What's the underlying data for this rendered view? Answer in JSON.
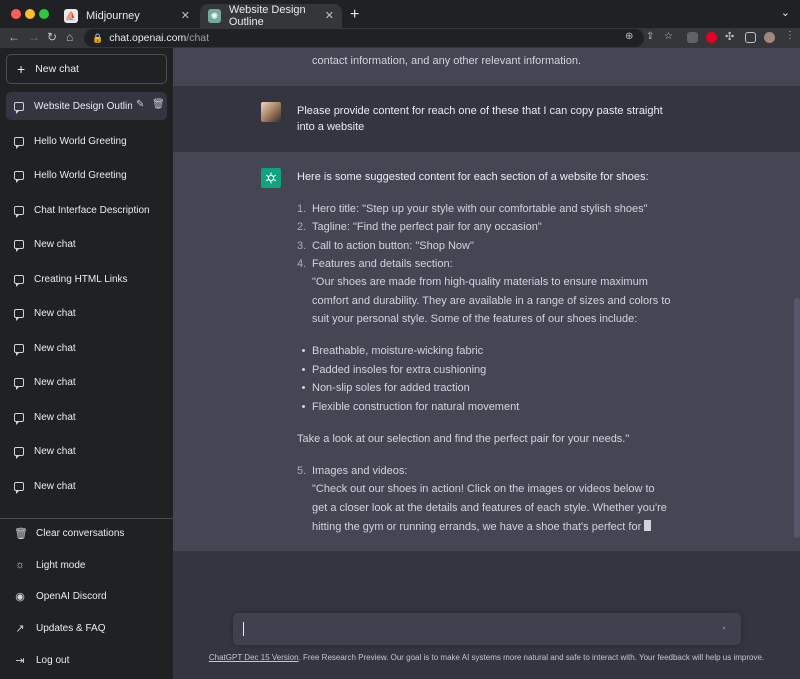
{
  "browser": {
    "tabs": [
      {
        "title": "Midjourney",
        "active": false
      },
      {
        "title": "Website Design Outline",
        "active": true
      }
    ],
    "url_host": "chat.openai.com",
    "url_path": "/chat"
  },
  "sidebar": {
    "new_chat_label": "New chat",
    "items": [
      {
        "label": "Website Design Outlin",
        "active": true
      },
      {
        "label": "Hello World Greeting"
      },
      {
        "label": "Hello World Greeting"
      },
      {
        "label": "Chat Interface Description"
      },
      {
        "label": "New chat"
      },
      {
        "label": "Creating HTML Links"
      },
      {
        "label": "New chat"
      },
      {
        "label": "New chat"
      },
      {
        "label": "New chat"
      },
      {
        "label": "New chat"
      },
      {
        "label": "New chat"
      },
      {
        "label": "New chat"
      }
    ],
    "bottom": {
      "clear": "Clear conversations",
      "light": "Light mode",
      "discord": "OpenAI Discord",
      "updates": "Updates & FAQ",
      "logout": "Log out"
    }
  },
  "chat": {
    "previous_tail": "contact information, and any other relevant information.",
    "user_message_line1": "Please provide content for reach one of these that I can copy paste straight",
    "user_message_line2": "into a website",
    "assistant": {
      "intro": "Here is some suggested content for each section of a website for shoes:",
      "list": [
        {
          "num": "1.",
          "text": "Hero title: \"Step up your style with our comfortable and stylish shoes\""
        },
        {
          "num": "2.",
          "text": "Tagline: \"Find the perfect pair for any occasion\""
        },
        {
          "num": "3.",
          "text": "Call to action button: \"Shop Now\""
        },
        {
          "num": "4.",
          "text": "Features and details section:"
        }
      ],
      "features_para": [
        "\"Our shoes are made from high-quality materials to ensure maximum",
        "comfort and durability. They are available in a range of sizes and colors to",
        "suit your personal style. Some of the features of our shoes include:"
      ],
      "bullets": [
        "Breathable, moisture-wicking fabric",
        "Padded insoles for extra cushioning",
        "Non-slip soles for added traction",
        "Flexible construction for natural movement"
      ],
      "closing": "Take a look at our selection and find the perfect pair for your needs.\"",
      "item5_num": "5.",
      "item5_title": "Images and videos:",
      "item5_para": [
        "\"Check out our shoes in action! Click on the images or videos below to",
        "get a closer look at the details and features of each style. Whether you're",
        "hitting the gym or running errands, we have a shoe that's perfect for"
      ]
    }
  },
  "footer": {
    "version_link": "ChatGPT Dec 15 Version",
    "text": ". Free Research Preview. Our goal is to make AI systems more natural and safe to interact with. Your feedback will help us improve."
  },
  "colors": {
    "sidebar_bg": "#202123",
    "main_bg": "#343541",
    "assistant_bg": "#444654",
    "gpt_green": "#10a37f"
  }
}
